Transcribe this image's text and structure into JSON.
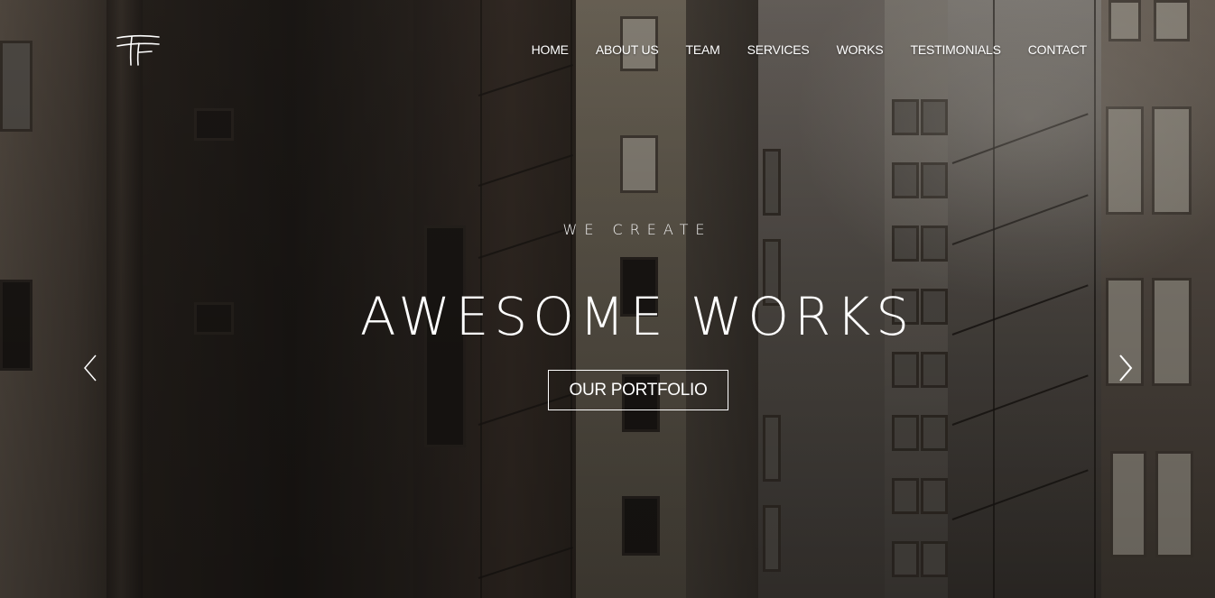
{
  "brand": {
    "logo_icon": "tf-monogram-logo"
  },
  "nav": {
    "items": [
      {
        "label": "HOME"
      },
      {
        "label": "ABOUT US"
      },
      {
        "label": "TEAM"
      },
      {
        "label": "SERVICES"
      },
      {
        "label": "WORKS"
      },
      {
        "label": "TESTIMONIALS"
      },
      {
        "label": "CONTACT"
      }
    ]
  },
  "hero": {
    "kicker": "WE CREATE",
    "headline": "AWESOME WORKS",
    "cta_label": "OUR PORTFOLIO",
    "prev_icon": "chevron-left-icon",
    "next_icon": "chevron-right-icon"
  },
  "colors": {
    "text": "#ffffff",
    "overlay": "#000000"
  }
}
